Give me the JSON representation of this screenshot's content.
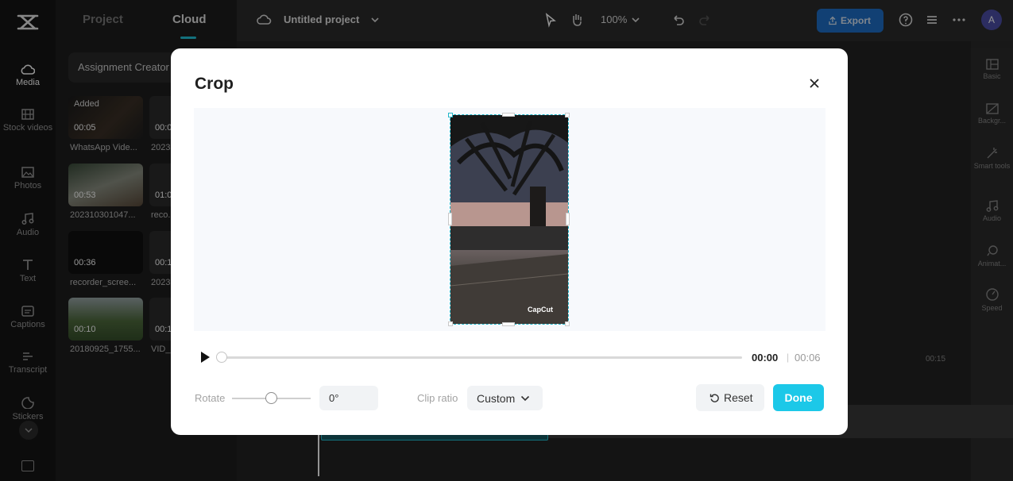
{
  "colors": {
    "accent": "#1cc8e8",
    "export": "#1e6fc8",
    "crop_border": "#1fb5c8"
  },
  "rail": {
    "items": [
      {
        "label": "Media",
        "icon": "cloud-icon"
      },
      {
        "label": "Stock videos",
        "icon": "film-icon"
      },
      {
        "label": "Photos",
        "icon": "image-icon"
      },
      {
        "label": "Audio",
        "icon": "music-note-icon"
      },
      {
        "label": "Text",
        "icon": "text-icon"
      },
      {
        "label": "Captions",
        "icon": "captions-icon"
      },
      {
        "label": "Transcript",
        "icon": "transcript-icon"
      },
      {
        "label": "Stickers",
        "icon": "sticker-icon"
      }
    ]
  },
  "panel": {
    "tabs": [
      "Project",
      "Cloud"
    ],
    "search_text": "Assignment Creator",
    "media": [
      {
        "name": "WhatsApp Vide...",
        "duration": "00:05",
        "badge": "Added"
      },
      {
        "name": "2023...",
        "duration": "00:0"
      },
      {
        "name": "202310301047...",
        "duration": "00:53"
      },
      {
        "name": "reco...",
        "duration": "01:0"
      },
      {
        "name": "recorder_scree...",
        "duration": "00:36"
      },
      {
        "name": "2023...",
        "duration": "00:1"
      },
      {
        "name": "20180925_1755...",
        "duration": "00:10"
      },
      {
        "name": "VID_...",
        "duration": "00:1"
      }
    ]
  },
  "topbar": {
    "project_title": "Untitled project",
    "zoom": "100%",
    "export_label": "Export",
    "avatar_initial": "A"
  },
  "rightbar": {
    "items": [
      {
        "label": "Basic",
        "icon": "basic-icon"
      },
      {
        "label": "Backgr...",
        "icon": "background-icon"
      },
      {
        "label": "Smart tools",
        "icon": "magic-wand-icon"
      },
      {
        "label": "Audio",
        "icon": "music-note-icon"
      },
      {
        "label": "Animat...",
        "icon": "animation-icon"
      },
      {
        "label": "Speed",
        "icon": "speed-icon"
      }
    ]
  },
  "timeline": {
    "marker": "00:15"
  },
  "crop": {
    "title": "Crop",
    "watermark": "CapCut",
    "time_current": "00:00",
    "time_separator": "|",
    "time_total": "00:06",
    "rotate_label": "Rotate",
    "rotate_value": "0°",
    "clip_ratio_label": "Clip ratio",
    "clip_ratio_value": "Custom",
    "reset_label": "Reset",
    "done_label": "Done"
  }
}
